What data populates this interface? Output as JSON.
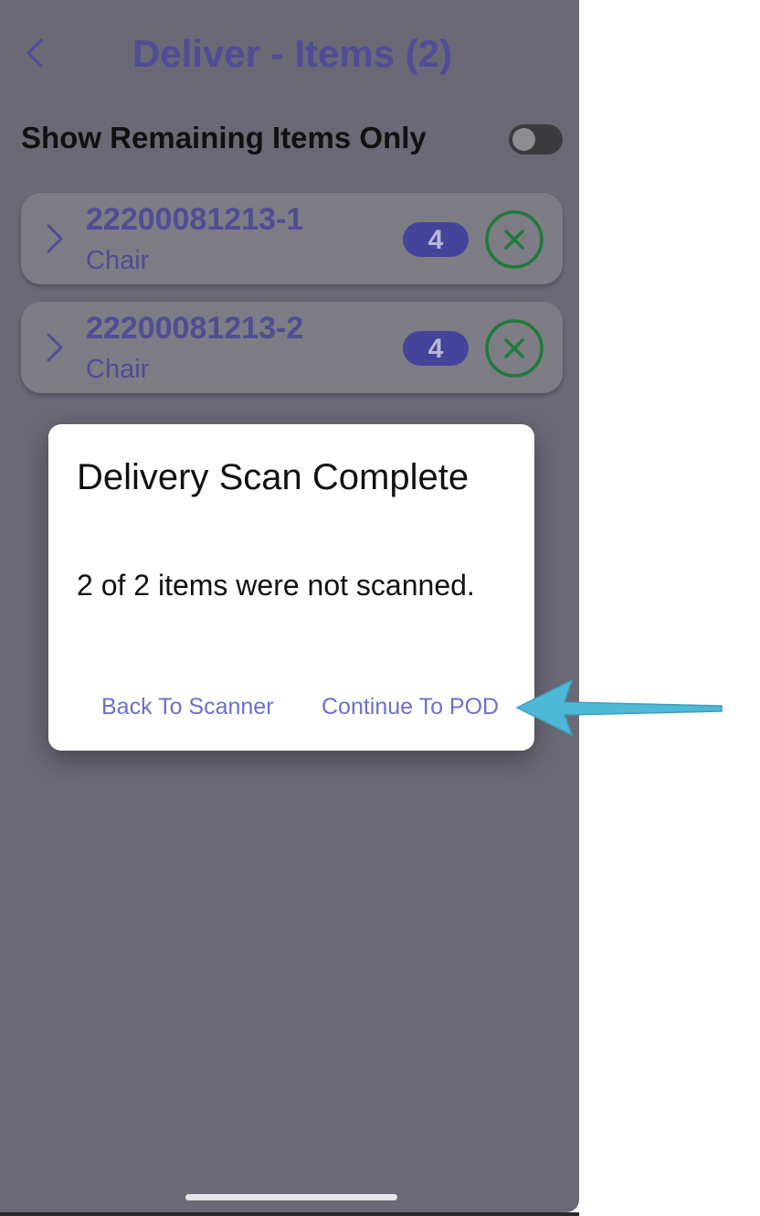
{
  "header": {
    "title": "Deliver - Items (2)"
  },
  "filter": {
    "label": "Show Remaining Items Only",
    "enabled": false
  },
  "items": [
    {
      "id": "22200081213-1",
      "name": "Chair",
      "quantity": "4",
      "status_icon": "close-circle-icon"
    },
    {
      "id": "22200081213-2",
      "name": "Chair",
      "quantity": "4",
      "status_icon": "close-circle-icon"
    }
  ],
  "dialog": {
    "title": "Delivery Scan Complete",
    "message": "2 of 2 items were not scanned.",
    "back_label": "Back To Scanner",
    "continue_label": "Continue To POD"
  },
  "colors": {
    "overlay_background": "#6b6976",
    "accent": "#4e4d95",
    "badge": "#44449a",
    "status_green": "#1e7a3a",
    "dialog_button": "#6d6fcb",
    "annotation_arrow": "#4fb8d6"
  },
  "icons": {
    "back": "chevron-left-icon",
    "expand": "chevron-right-icon",
    "annotation": "arrow-left-icon"
  }
}
